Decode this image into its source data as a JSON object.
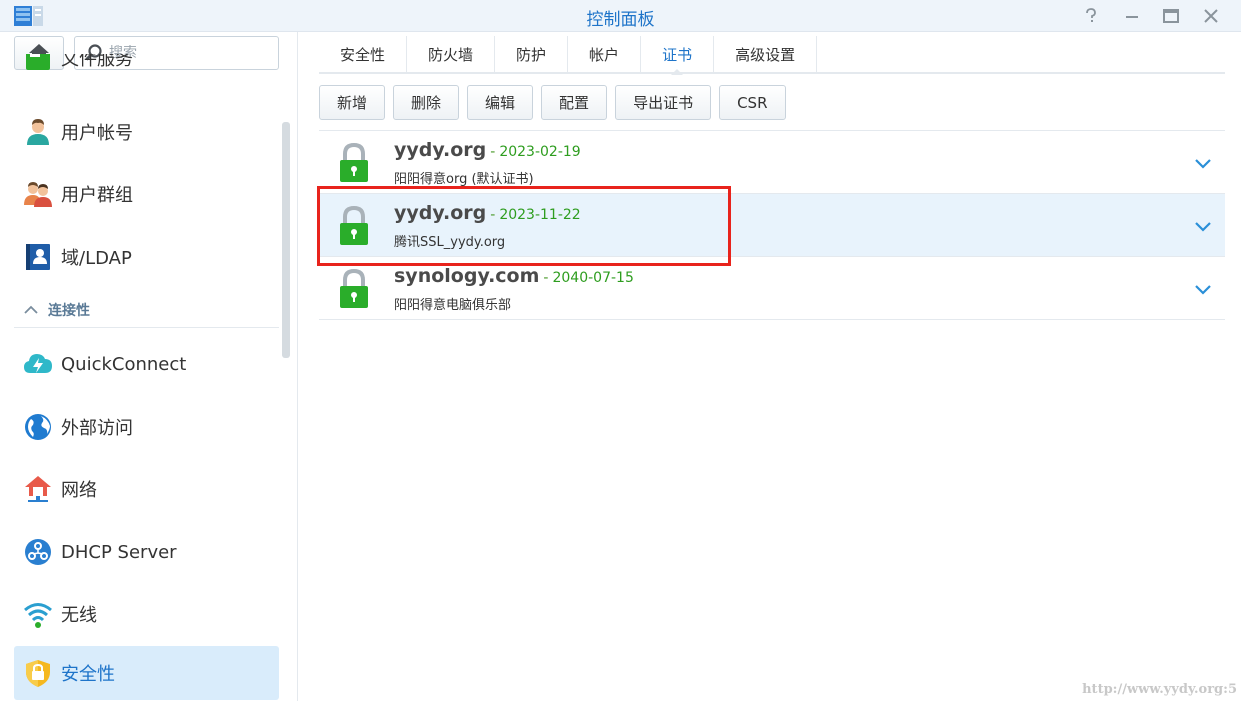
{
  "window": {
    "title": "控制面板",
    "controls": {
      "help": "help-icon",
      "minimize": "minimize-icon",
      "maximize": "maximize-icon",
      "close": "close-icon"
    }
  },
  "sidebar": {
    "search_placeholder": "搜索",
    "partial_item": "文件服务",
    "items": [
      {
        "label": "用户帐号",
        "icon": "user-icon"
      },
      {
        "label": "用户群组",
        "icon": "group-icon"
      },
      {
        "label": "域/LDAP",
        "icon": "ldap-icon"
      }
    ],
    "section": {
      "label": "连接性",
      "icon": "chevron-up-icon"
    },
    "items2": [
      {
        "label": "QuickConnect",
        "icon": "quickconnect-icon"
      },
      {
        "label": "外部访问",
        "icon": "globe-icon"
      },
      {
        "label": "网络",
        "icon": "network-icon"
      },
      {
        "label": "DHCP Server",
        "icon": "dhcp-icon"
      },
      {
        "label": "无线",
        "icon": "wifi-icon"
      },
      {
        "label": "安全性",
        "icon": "shield-icon",
        "active": true
      }
    ]
  },
  "tabs": [
    {
      "label": "安全性"
    },
    {
      "label": "防火墙"
    },
    {
      "label": "防护"
    },
    {
      "label": "帐户"
    },
    {
      "label": "证书",
      "active": true
    },
    {
      "label": "高级设置"
    }
  ],
  "toolbar": {
    "buttons": [
      "新增",
      "删除",
      "编辑",
      "配置",
      "导出证书",
      "CSR"
    ]
  },
  "certificates": [
    {
      "name": "yydy.org",
      "separator": "-",
      "date": "2023-02-19",
      "description": "阳阳得意org (默认证书)"
    },
    {
      "name": "yydy.org",
      "separator": "-",
      "date": "2023-11-22",
      "description": "腾讯SSL_yydy.org",
      "selected": true
    },
    {
      "name": "synology.com",
      "separator": "-",
      "date": "2040-07-15",
      "description": "阳阳得意电脑俱乐部"
    }
  ],
  "watermark": "http://www.yydy.org:5",
  "colors": {
    "accent": "#1e74c9",
    "date_green": "#2e9d1f",
    "lock_green": "#2aad2a",
    "highlight_red": "#e8231c",
    "selected_bg": "#e8f3fc"
  }
}
